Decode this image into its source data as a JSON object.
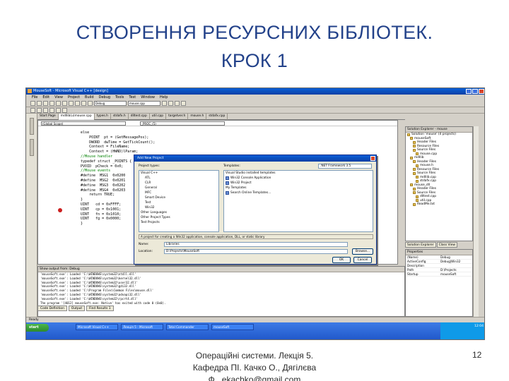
{
  "slide": {
    "title_line1": "СТВОРЕННЯ РЕСУРСНИХ БІБЛІОТЕК.",
    "title_line2": "КРОК 1",
    "footer_line1": "Операційні системи. Лекція 5.",
    "footer_line2": "Кафедра ПІ. Качко О., Дягілєва",
    "footer_line3": "Ф., ekachko@gmail.com",
    "page_number": "12"
  },
  "ide": {
    "window_title": "MouseSoft - Microsoft Visual C++ [design]",
    "menu": [
      "File",
      "Edit",
      "View",
      "Project",
      "Build",
      "Debug",
      "Tools",
      "Test",
      "Window",
      "Help"
    ],
    "toolbar_combo": "Debug",
    "toolbar_combo2": "mouse.cpp",
    "doc_tabs": [
      "Start Page",
      "mdllib(u)mouse.cpp",
      "types.h",
      "stdafx.h",
      "dlltest.cpp",
      "util.cpp",
      "targetver.h",
      "mouse.h",
      "stdafx.cpp"
    ],
    "editor_combo_left": "(Global Scope)",
    "editor_combo_right": "_PROC_(5)",
    "code_lines": [
      "    else",
      "        POINT  pt = (GetMessagePos);",
      "        DWORD  dwTime = GetTickCount();",
      "",
      "        Context = FileName;",
      "        Context = (HWND)lParam;",
      "",
      "",
      "    //Mouse handler",
      "    typedef struct _POINTS {",
      "    PVOID  pCheck = 0x0;",
      "",
      "    //Mouse events",
      "    #define  MSG1  0x0200",
      "    #define  MSG2  0x0201",
      "    #define  MSG3  0x0202",
      "    #define  MSG4  0x0203",
      "        return TRUE;",
      "    }",
      "",
      "    UINT   cd = 0xFFFF;",
      "    UINT   cp = 0x1001;",
      "    UINT   fn = 0x1010;",
      "    UINT   fg = 0x0000;",
      "    }"
    ],
    "output_header": "Show output from: Debug",
    "output_lines": [
      "'mouseSoft.exe': Loaded 'C:\\WINDOWS\\system32\\ntdll.dll'",
      "'mouseSoft.exe': Loaded 'C:\\WINDOWS\\system32\\kernel32.dll'",
      "'mouseSoft.exe': Loaded 'C:\\WINDOWS\\system32\\user32.dll'",
      "'mouseSoft.exe': Loaded 'C:\\WINDOWS\\system32\\gdi32.dll'",
      "'mouseSoft.exe': Loaded 'C:\\Program Files\\Common Files\\mouse.dll'",
      "'mouseSoft.exe': Loaded 'C:\\WINDOWS\\system32\\advapi32.dll'",
      "'mouseSoft.exe': Loaded 'C:\\WINDOWS\\system32\\rpcrt4.dll'",
      "The program '[4012] mouseSoft.exe: Native' has exited with code 0 (0x0)."
    ],
    "output_tabs": [
      "Code Definition",
      "Output",
      "Find Results 1"
    ],
    "status": "Ready",
    "sol_header": "Solution Explorer - mouse",
    "sol_items": [
      "Solution 'mouse' (4 projects)",
      "mouseSoft",
      "Header Files",
      "Resource Files",
      "Source Files",
      "mouse.cpp",
      "mdllib",
      "Header Files",
      "mouse.h",
      "Resource Files",
      "Source Files",
      "mdllib.cpp",
      "stdafx.cpp",
      "mouse_dll",
      "Header Files",
      "Source Files",
      "dlltest.cpp",
      "util.cpp",
      "ReadMe.txt"
    ],
    "sol_tabs": [
      "Solution Explorer",
      "Class View"
    ],
    "props_header": "Properties",
    "props": [
      [
        "(Name)",
        "Debug"
      ],
      [
        "ActiveConfig",
        "Debug|Win32"
      ],
      [
        "Description",
        ""
      ],
      [
        "Path",
        "D:\\Projects"
      ],
      [
        "Startup",
        "mouseSoft"
      ]
    ],
    "taskbar_start": "start",
    "taskbar_buttons": [
      "Microsoft Visual C++",
      "Лекція 5 - Microsoft",
      "Total Commander",
      "mouseSoft"
    ],
    "clock": "12:04"
  },
  "dialog": {
    "title": "Add New Project",
    "project_types_label": "Project types:",
    "templates_label": "Templates:",
    "framework": ".NET Framework 3.5",
    "project_types": [
      "Visual C++",
      "ATL",
      "CLR",
      "General",
      "MFC",
      "Smart Device",
      "Test",
      "Win32",
      "Other Languages",
      "Other Project Types",
      "Test Projects"
    ],
    "installed_header": "Visual Studio installed templates",
    "installed_templates": [
      "Win32 Console Application",
      "Win32 Project"
    ],
    "my_templates_header": "My Templates",
    "my_templates": [
      "Search Online Templates..."
    ],
    "description": "A project for creating a Win32 application, console application, DLL, or static library",
    "name_label": "Name:",
    "name_value": "Libraries",
    "location_label": "Location:",
    "location_value": "D:\\Projects\\MouseSoft",
    "browse_label": "Browse...",
    "ok_label": "OK",
    "cancel_label": "Cancel"
  }
}
